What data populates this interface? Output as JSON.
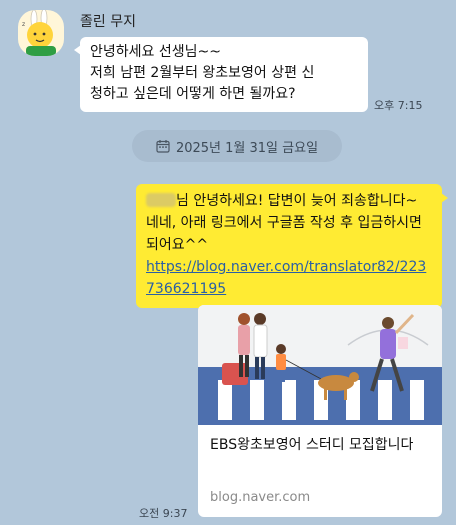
{
  "chat": {
    "sender_name": "졸린 무지",
    "incoming": {
      "lines": [
        "안녕하세요 선생님~~",
        "저희 남편 2월부터 왕초보영어 상편 신",
        "청하고 싶은데 어떻게 하면 될까요?"
      ],
      "time": "오후 7:15"
    },
    "date_divider": {
      "label": "2025년 1월 31일 금요일",
      "icon": "calendar-icon"
    },
    "outgoing": {
      "text_after_name": "님 안녕하세요! 답변이 늦어 죄송합니다~ 네네, 아래 링크에서 구글폼 작성 후 입금하시면 되어요^^",
      "link": "https://blog.naver.com/translator82/223736621195",
      "time": "오전 9:37"
    },
    "link_preview": {
      "title": "EBS왕초보영어 스터디 모집합니다",
      "domain": "blog.naver.com"
    }
  }
}
